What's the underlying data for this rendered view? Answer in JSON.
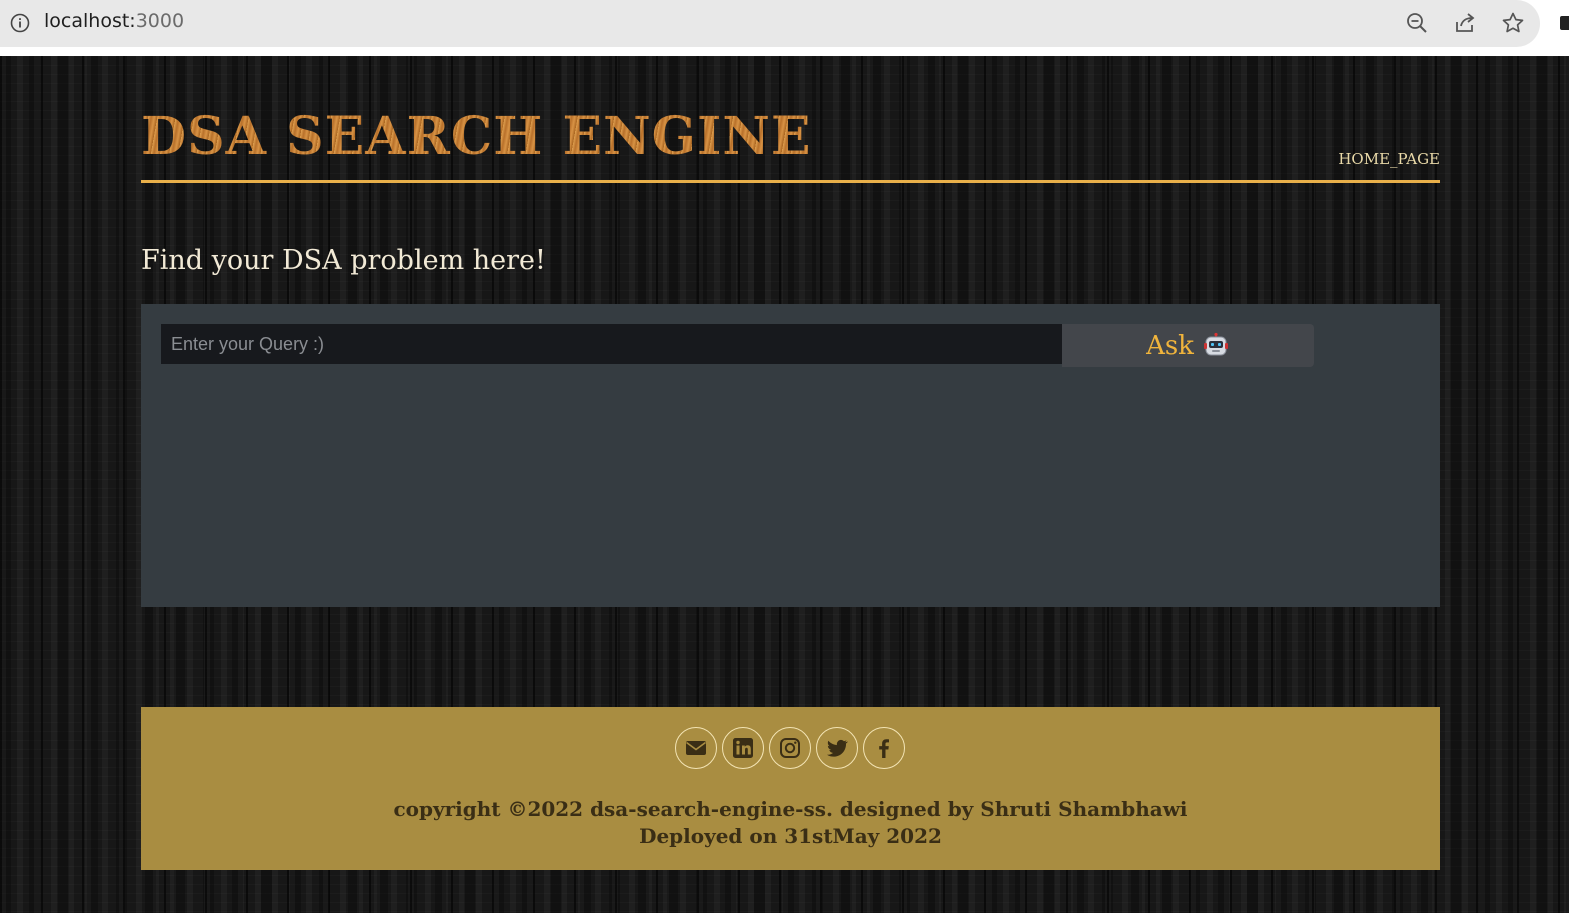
{
  "browser": {
    "url_host": "localhost:",
    "url_port": "3000",
    "icons": [
      "info-icon",
      "zoom-out-icon",
      "share-icon",
      "bookmark-star-icon"
    ]
  },
  "header": {
    "title": "DSA SEARCH ENGINE",
    "nav_link": "HOME_PAGE",
    "accent_color": "#e9b04a"
  },
  "main": {
    "heading": "Find your DSA problem here!",
    "search": {
      "placeholder": "Enter your Query :)",
      "value": ""
    },
    "ask_button": {
      "label": "Ask",
      "icon": "robot-icon"
    }
  },
  "footer": {
    "social_icons": [
      "envelope-icon",
      "linkedin-icon",
      "instagram-icon",
      "twitter-icon",
      "facebook-icon"
    ],
    "copyright": "copyright ©2022 dsa-search-engine-ss. designed by Shruti Shambhawi",
    "deployed": "Deployed on 31stMay 2022",
    "background_color": "#a98d41"
  }
}
